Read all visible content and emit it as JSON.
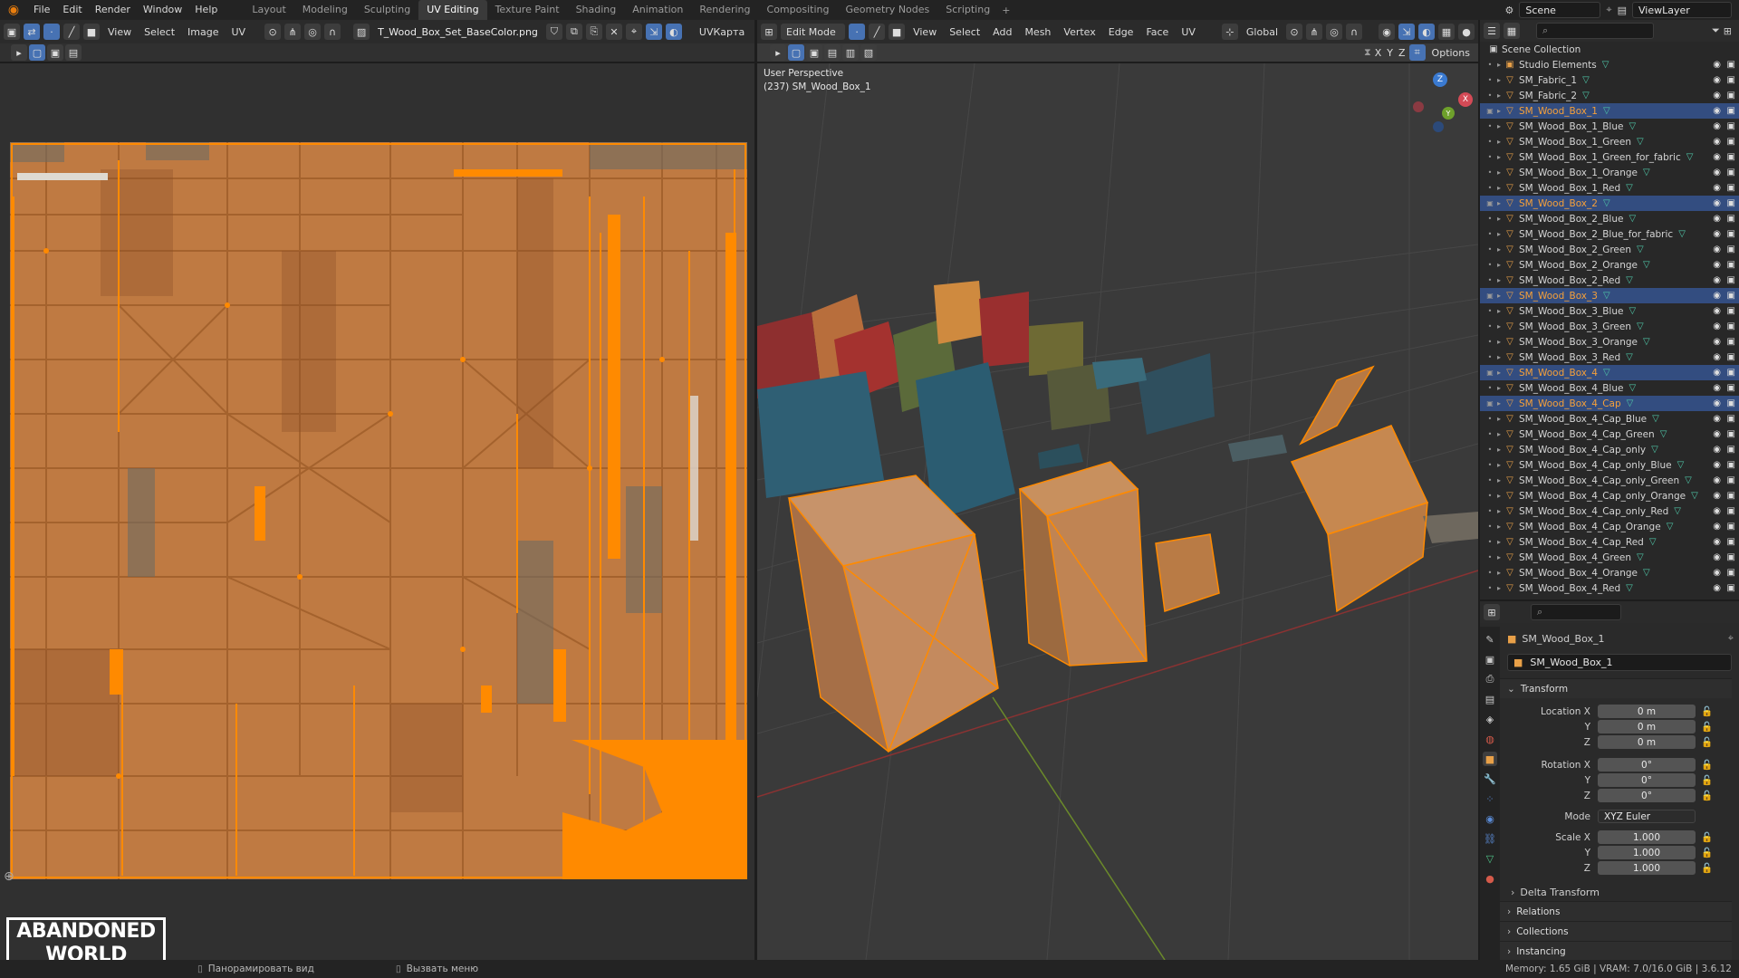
{
  "menu": [
    "File",
    "Edit",
    "Render",
    "Window",
    "Help"
  ],
  "workspaces": [
    "Layout",
    "Modeling",
    "Sculpting",
    "UV Editing",
    "Texture Paint",
    "Shading",
    "Animation",
    "Rendering",
    "Compositing",
    "Geometry Nodes",
    "Scripting"
  ],
  "active_workspace": "UV Editing",
  "scene": "Scene",
  "view_layer": "ViewLayer",
  "uv_editor": {
    "menus": [
      "View",
      "Select",
      "Image",
      "UV"
    ],
    "image_name": "T_Wood_Box_Set_BaseColor.png",
    "uv_map": "UVКарта"
  },
  "viewport": {
    "mode": "Edit Mode",
    "menus": [
      "View",
      "Select",
      "Add",
      "Mesh",
      "Vertex",
      "Edge",
      "Face",
      "UV"
    ],
    "orientation": "Global",
    "options_label": "Options",
    "overlay_line1": "User Perspective",
    "overlay_line2": "(237) SM_Wood_Box_1",
    "axes": [
      "X",
      "Y",
      "Z"
    ],
    "gizmo": {
      "x": "X",
      "y": "Y",
      "z": "Z"
    }
  },
  "outliner": {
    "collection": "Scene Collection",
    "items": [
      {
        "name": "Studio Elements",
        "selected": false,
        "hl": false
      },
      {
        "name": "SM_Fabric_1",
        "selected": false,
        "hl": false
      },
      {
        "name": "SM_Fabric_2",
        "selected": false,
        "hl": false
      },
      {
        "name": "SM_Wood_Box_1",
        "selected": true,
        "hl": true
      },
      {
        "name": "SM_Wood_Box_1_Blue",
        "selected": false,
        "hl": false
      },
      {
        "name": "SM_Wood_Box_1_Green",
        "selected": false,
        "hl": false
      },
      {
        "name": "SM_Wood_Box_1_Green_for_fabric",
        "selected": false,
        "hl": false
      },
      {
        "name": "SM_Wood_Box_1_Orange",
        "selected": false,
        "hl": false
      },
      {
        "name": "SM_Wood_Box_1_Red",
        "selected": false,
        "hl": false
      },
      {
        "name": "SM_Wood_Box_2",
        "selected": true,
        "hl": true
      },
      {
        "name": "SM_Wood_Box_2_Blue",
        "selected": false,
        "hl": false
      },
      {
        "name": "SM_Wood_Box_2_Blue_for_fabric",
        "selected": false,
        "hl": false
      },
      {
        "name": "SM_Wood_Box_2_Green",
        "selected": false,
        "hl": false
      },
      {
        "name": "SM_Wood_Box_2_Orange",
        "selected": false,
        "hl": false
      },
      {
        "name": "SM_Wood_Box_2_Red",
        "selected": false,
        "hl": false
      },
      {
        "name": "SM_Wood_Box_3",
        "selected": true,
        "hl": true
      },
      {
        "name": "SM_Wood_Box_3_Blue",
        "selected": false,
        "hl": false
      },
      {
        "name": "SM_Wood_Box_3_Green",
        "selected": false,
        "hl": false
      },
      {
        "name": "SM_Wood_Box_3_Orange",
        "selected": false,
        "hl": false
      },
      {
        "name": "SM_Wood_Box_3_Red",
        "selected": false,
        "hl": false
      },
      {
        "name": "SM_Wood_Box_4",
        "selected": true,
        "hl": true
      },
      {
        "name": "SM_Wood_Box_4_Blue",
        "selected": false,
        "hl": false
      },
      {
        "name": "SM_Wood_Box_4_Cap",
        "selected": true,
        "hl": true
      },
      {
        "name": "SM_Wood_Box_4_Cap_Blue",
        "selected": false,
        "hl": false
      },
      {
        "name": "SM_Wood_Box_4_Cap_Green",
        "selected": false,
        "hl": false
      },
      {
        "name": "SM_Wood_Box_4_Cap_only",
        "selected": false,
        "hl": false
      },
      {
        "name": "SM_Wood_Box_4_Cap_only_Blue",
        "selected": false,
        "hl": false
      },
      {
        "name": "SM_Wood_Box_4_Cap_only_Green",
        "selected": false,
        "hl": false
      },
      {
        "name": "SM_Wood_Box_4_Cap_only_Orange",
        "selected": false,
        "hl": false
      },
      {
        "name": "SM_Wood_Box_4_Cap_only_Red",
        "selected": false,
        "hl": false
      },
      {
        "name": "SM_Wood_Box_4_Cap_Orange",
        "selected": false,
        "hl": false
      },
      {
        "name": "SM_Wood_Box_4_Cap_Red",
        "selected": false,
        "hl": false
      },
      {
        "name": "SM_Wood_Box_4_Green",
        "selected": false,
        "hl": false
      },
      {
        "name": "SM_Wood_Box_4_Orange",
        "selected": false,
        "hl": false
      },
      {
        "name": "SM_Wood_Box_4_Red",
        "selected": false,
        "hl": false
      }
    ]
  },
  "properties": {
    "object_name": "SM_Wood_Box_1",
    "data_name": "SM_Wood_Box_1",
    "transform_label": "Transform",
    "location_label": "Location X",
    "rotation_label": "Rotation X",
    "scale_label": "Scale X",
    "y_label": "Y",
    "z_label": "Z",
    "location": [
      "0 m",
      "0 m",
      "0 m"
    ],
    "rotation": [
      "0°",
      "0°",
      "0°"
    ],
    "mode_label": "Mode",
    "mode_value": "XYZ Euler",
    "scale": [
      "1.000",
      "1.000",
      "1.000"
    ],
    "panels": [
      "Delta Transform",
      "Relations",
      "Collections",
      "Instancing"
    ]
  },
  "status": {
    "pan_view": "Панорамировать вид",
    "call_menu": "Вызвать меню",
    "memory": "Memory: 1.65 GiB | VRAM: 7.0/16.0 GiB | 3.6.12"
  },
  "brand": {
    "line1": "ABANDONED",
    "line2": "WORLD"
  },
  "colors": {
    "accent": "#e87d0d",
    "selection": "#334d80",
    "button_active": "#4772b3",
    "uv_wire": "#ff8a00"
  }
}
